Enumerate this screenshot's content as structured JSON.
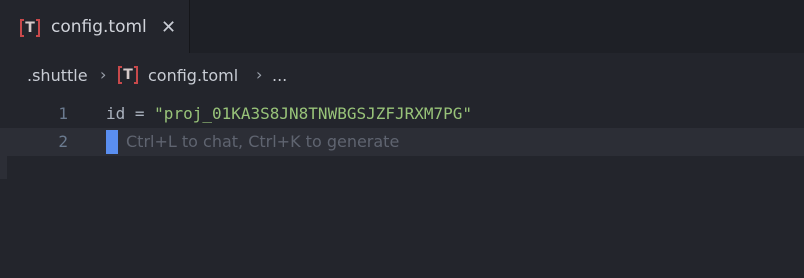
{
  "tab": {
    "title": "config.toml",
    "icon": "toml-file-icon",
    "icon_letter": "T",
    "close_glyph": "✕"
  },
  "breadcrumb": {
    "folder": ".shuttle",
    "separator": "›",
    "file": "config.toml",
    "more": "..."
  },
  "editor": {
    "lines": [
      {
        "number": "1",
        "key": "id",
        "operator": " = ",
        "value": "\"proj_01KA3S8JN8TNWBGSJZFJRXM7PG\""
      },
      {
        "number": "2",
        "hint": "Ctrl+L to chat, Ctrl+K to generate"
      }
    ]
  },
  "colors": {
    "background": "#23252c",
    "tabbar": "#1e2026",
    "string": "#98c379",
    "cursor": "#5a8ef0",
    "toml_icon_bracket": "#c8494b"
  }
}
